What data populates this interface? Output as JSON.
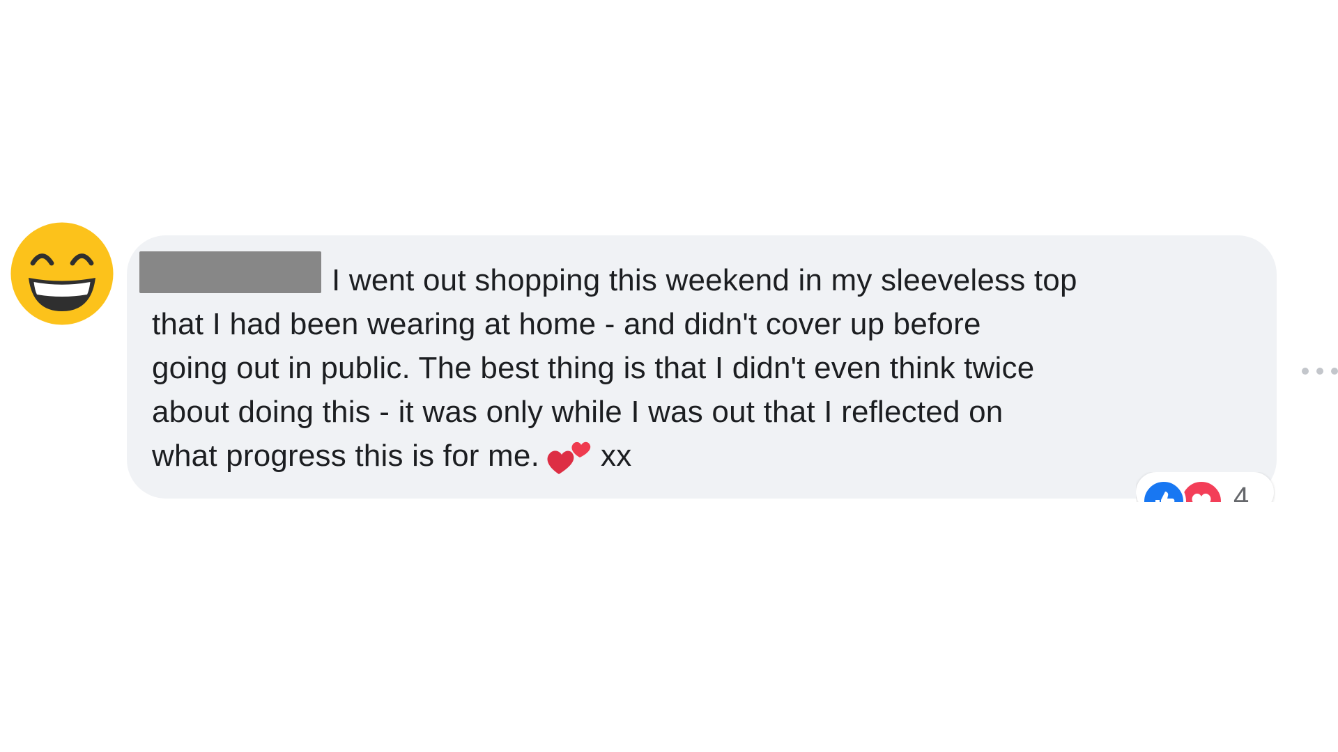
{
  "comment": {
    "author_name_redacted": true,
    "lines": [
      "I went out shopping this weekend in my sleeveless top",
      "that I had been wearing at home - and didn't cover up before",
      "going out in public. The best thing is that I didn't even think twice",
      "about doing this - it was only while I was out that I reflected on"
    ],
    "last_line_before_emoji": "what progress this is for me.",
    "last_line_after_emoji": "xx",
    "inline_emoji": "two-hearts",
    "bubble_color": "#f0f2f5",
    "text_color": "#1c1e21"
  },
  "avatar": {
    "icon": "grinning-face-smiling-eyes-icon",
    "color": "#fcc21b"
  },
  "reactions": {
    "types": [
      "like",
      "love"
    ],
    "count": "4",
    "like_color": "#1877f2",
    "love_color": "#f33e58"
  },
  "more_options": {
    "icon": "more-horizontal-icon"
  }
}
